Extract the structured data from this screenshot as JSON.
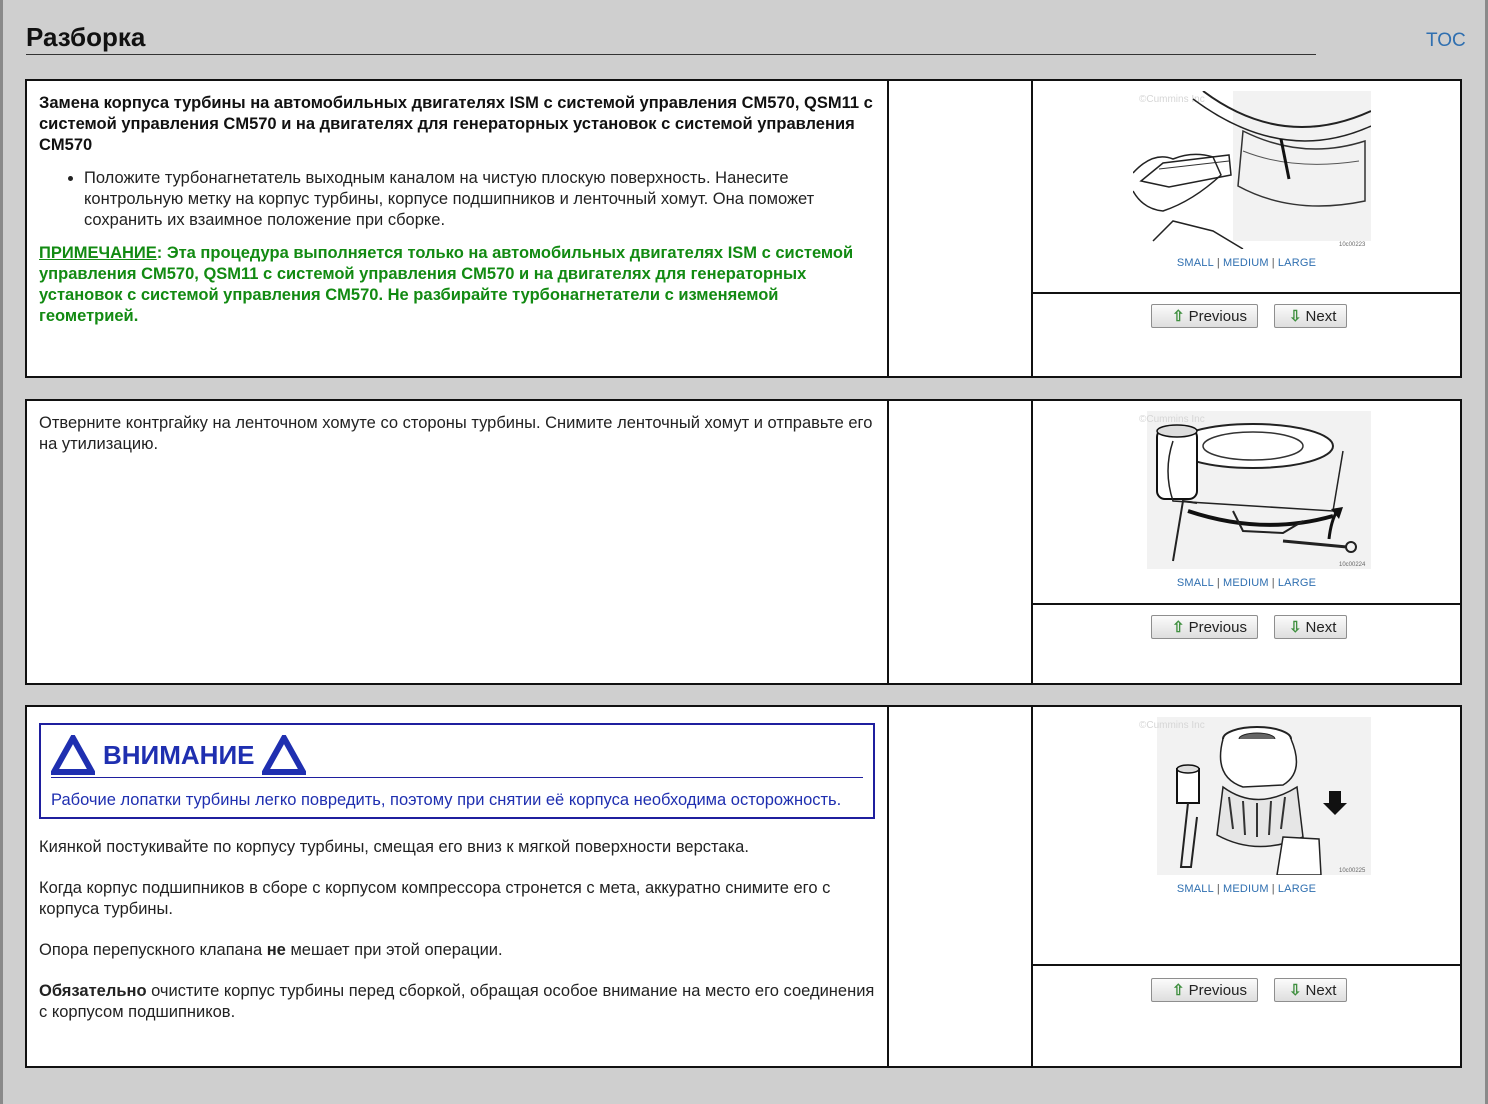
{
  "header": {
    "title": "Разборка",
    "toc": "TOC"
  },
  "steps": [
    {
      "heading": "Замена корпуса турбины на автомобильных двигателях ISM с системой управления CM570, QSM11 с системой управления CM570 и на двигателях для генераторных установок с системой управления CM570",
      "bullet": "Положите турбонагнетатель выходным каналом на чистую плоскую поверхность. Нанесите контрольную метку на корпус турбины, корпусе подшипников и ленточный хомут. Она поможет сохранить их взаимное положение при сборке.",
      "note_label": "ПРИМЕЧАНИЕ",
      "note_text": ": Эта процедура выполняется только на автомобильных двигателях ISM с системой управления CM570, QSM11 с системой управления CM570 и на двигателях для генераторных установок с системой управления CM570. Не разбирайте турбонагнетатели с изменяемой геометрией.",
      "image_code": "10c00223"
    },
    {
      "text": "Отверните контргайку на ленточном хомуте со стороны турбины. Снимите ленточный хомут и отправьте его на утилизацию.",
      "image_code": "10c00224"
    },
    {
      "caution_title": "ВНИМАНИЕ",
      "caution_text": "Рабочие лопатки турбины легко повредить, поэтому при снятии её корпуса необходима осторожность.",
      "p1": "Киянкой постукивайте по корпусу турбины, смещая его вниз к мягкой поверхности верстака.",
      "p2": "Когда корпус подшипников в сборе с корпусом компрессора стронется с мета, аккуратно снимите его с корпуса турбины.",
      "p3_before": "Опора перепускного клапана ",
      "p3_bold": "не",
      "p3_after": " мешает при этой операции.",
      "p4_bold": "Обязательно",
      "p4_after": " очистите корпус турбины перед сборкой, обращая особое внимание на место его соединения с корпусом подшипников.",
      "image_code": "10c00225"
    }
  ],
  "image_links": {
    "small": "SMALL",
    "medium": "MEDIUM",
    "large": "LARGE",
    "sep": "|"
  },
  "watermark": "©Cummins Inc",
  "nav": {
    "previous": "Previous",
    "next": "Next"
  },
  "colors": {
    "note_green": "#128a12",
    "caution_blue": "#1f2fb0",
    "link_blue": "#2f6fb0"
  }
}
